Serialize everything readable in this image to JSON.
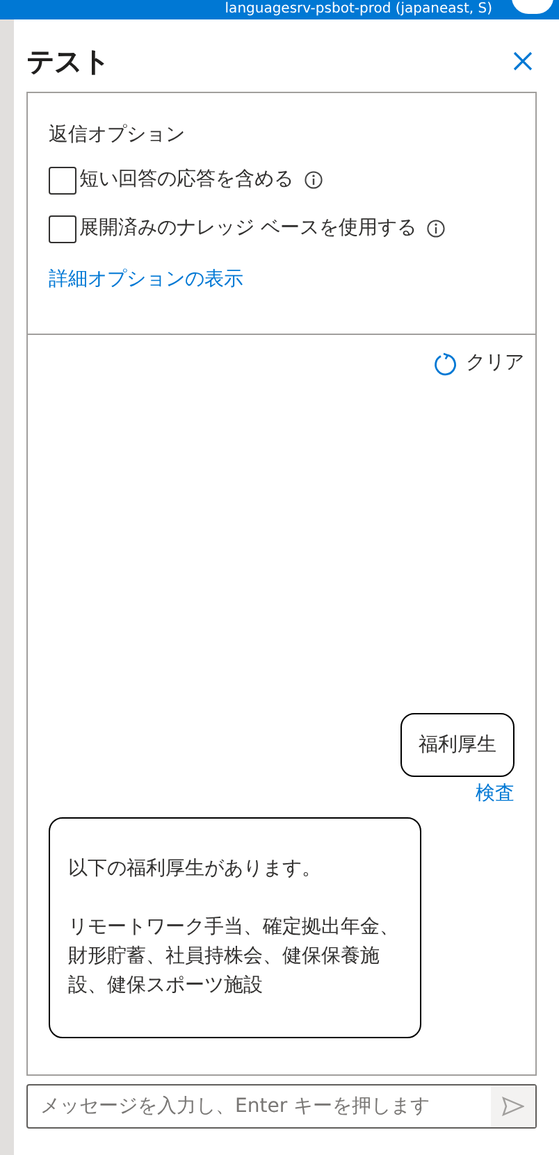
{
  "top_bar": {
    "resource": "languagesrv-psbot-prod (japaneast, S)"
  },
  "panel": {
    "title": "テスト"
  },
  "reply_options": {
    "heading": "返信オプション",
    "options": [
      {
        "label": "短い回答の応答を含める",
        "checked": false
      },
      {
        "label": "展開済みのナレッジ ベースを使用する",
        "checked": false
      }
    ],
    "link": "詳細オプションの表示"
  },
  "chat": {
    "clear_label": "クリア",
    "messages": [
      {
        "kind": "user",
        "paragraphs": [
          "福利厚生"
        ],
        "action": "検査"
      },
      {
        "kind": "bot",
        "paragraphs": [
          "以下の福利厚生があります。",
          "リモートワーク手当、確定拠出年金、財形貯蓄、社員持株会、健保保養施設、健保スポーツ施設"
        ]
      }
    ]
  },
  "input": {
    "placeholder": "メッセージを入力し、Enter キーを押します"
  }
}
